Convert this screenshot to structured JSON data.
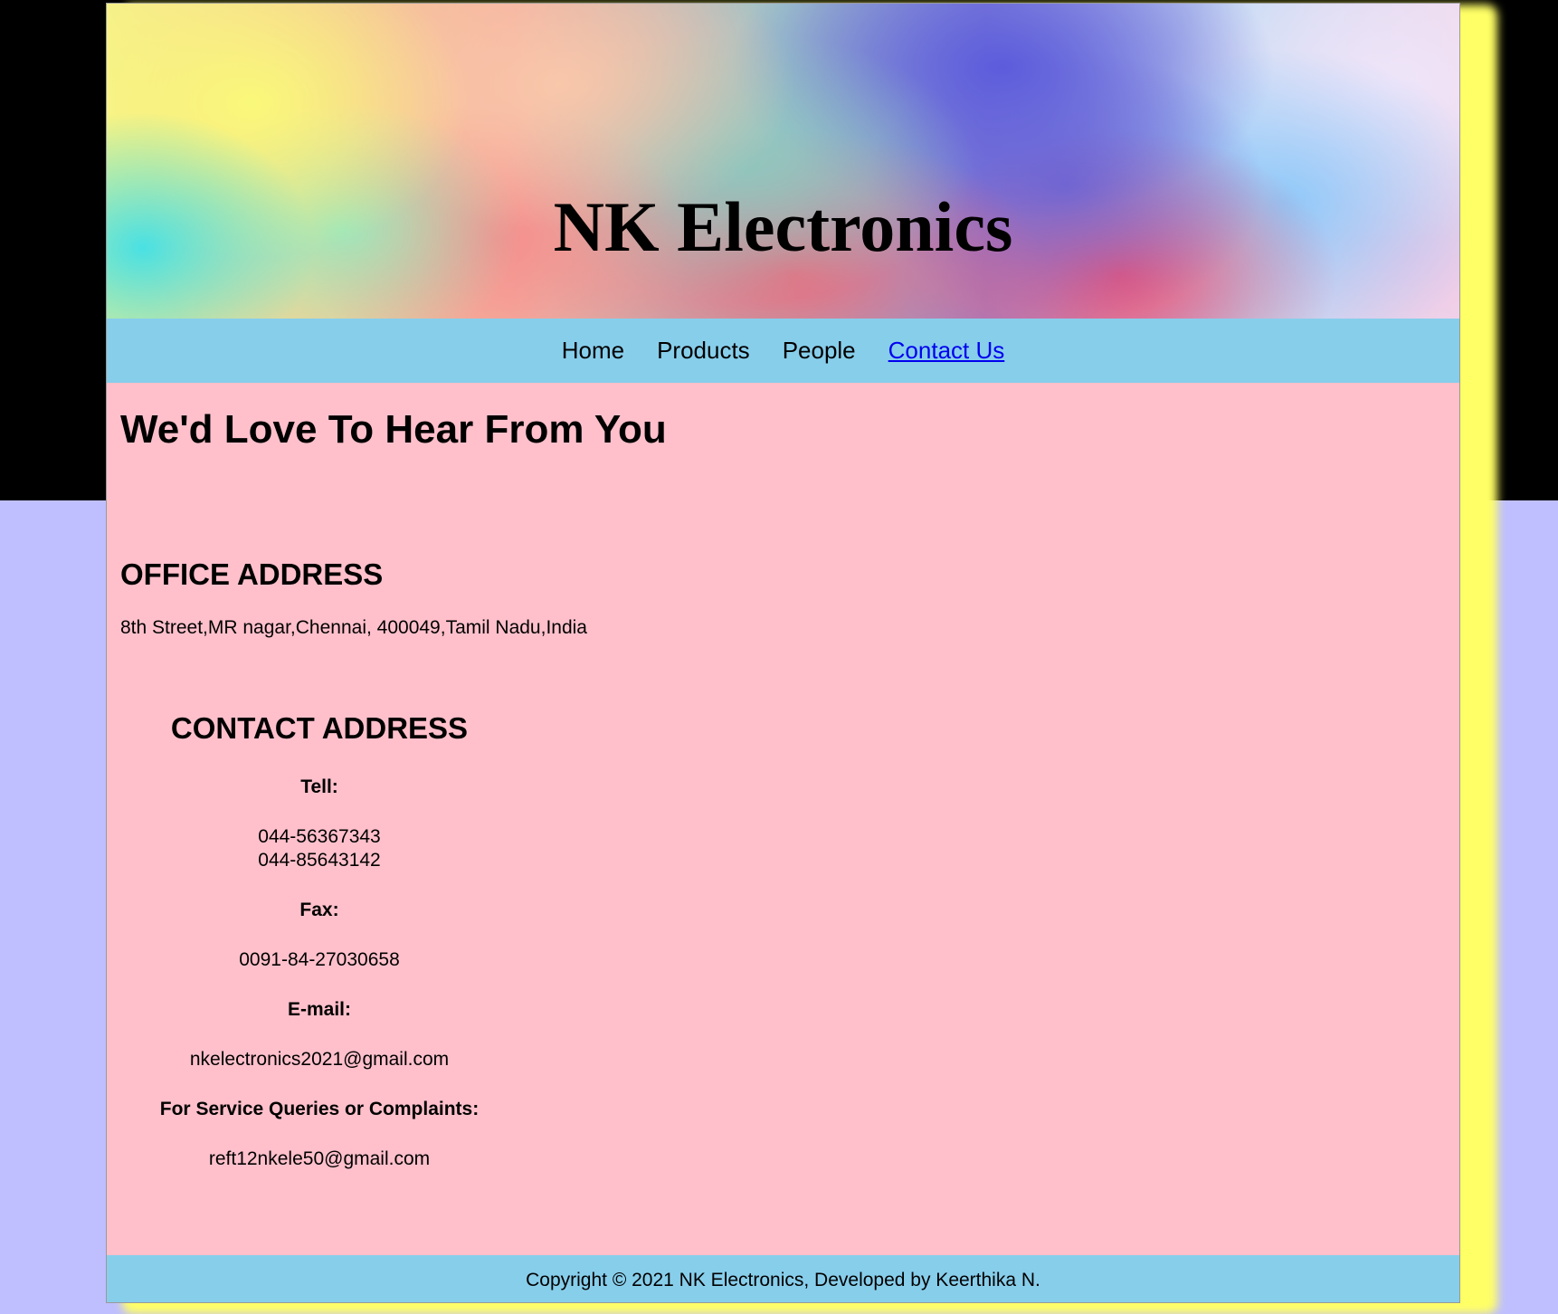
{
  "site": {
    "title": "NK Electronics"
  },
  "nav": {
    "items": [
      {
        "label": "Home"
      },
      {
        "label": "Products"
      },
      {
        "label": "People"
      },
      {
        "label": "Contact Us"
      }
    ]
  },
  "main": {
    "heading": "We'd Love To Hear From You",
    "office": {
      "heading": "OFFICE ADDRESS",
      "address": "8th Street,MR nagar,Chennai, 400049,Tamil Nadu,India"
    },
    "contact": {
      "heading": "CONTACT ADDRESS",
      "tel_label": "Tell:",
      "tel_values": [
        "044-56367343",
        "044-85643142"
      ],
      "fax_label": "Fax:",
      "fax_value": "0091-84-27030658",
      "email_label": "E-mail:",
      "email_value": "nkelectronics2021@gmail.com",
      "service_label": "For Service Queries or Complaints:",
      "service_value": "reft12nkele50@gmail.com"
    }
  },
  "footer": {
    "text": "Copyright © 2021 NK Electronics, Developed by Keerthika N."
  },
  "colors": {
    "nav_background": "#87ceeb",
    "content_background": "#ffc0cb",
    "page_background": "#bfbfff",
    "active_link": "#0000ee",
    "shadow": "#ffff66"
  }
}
